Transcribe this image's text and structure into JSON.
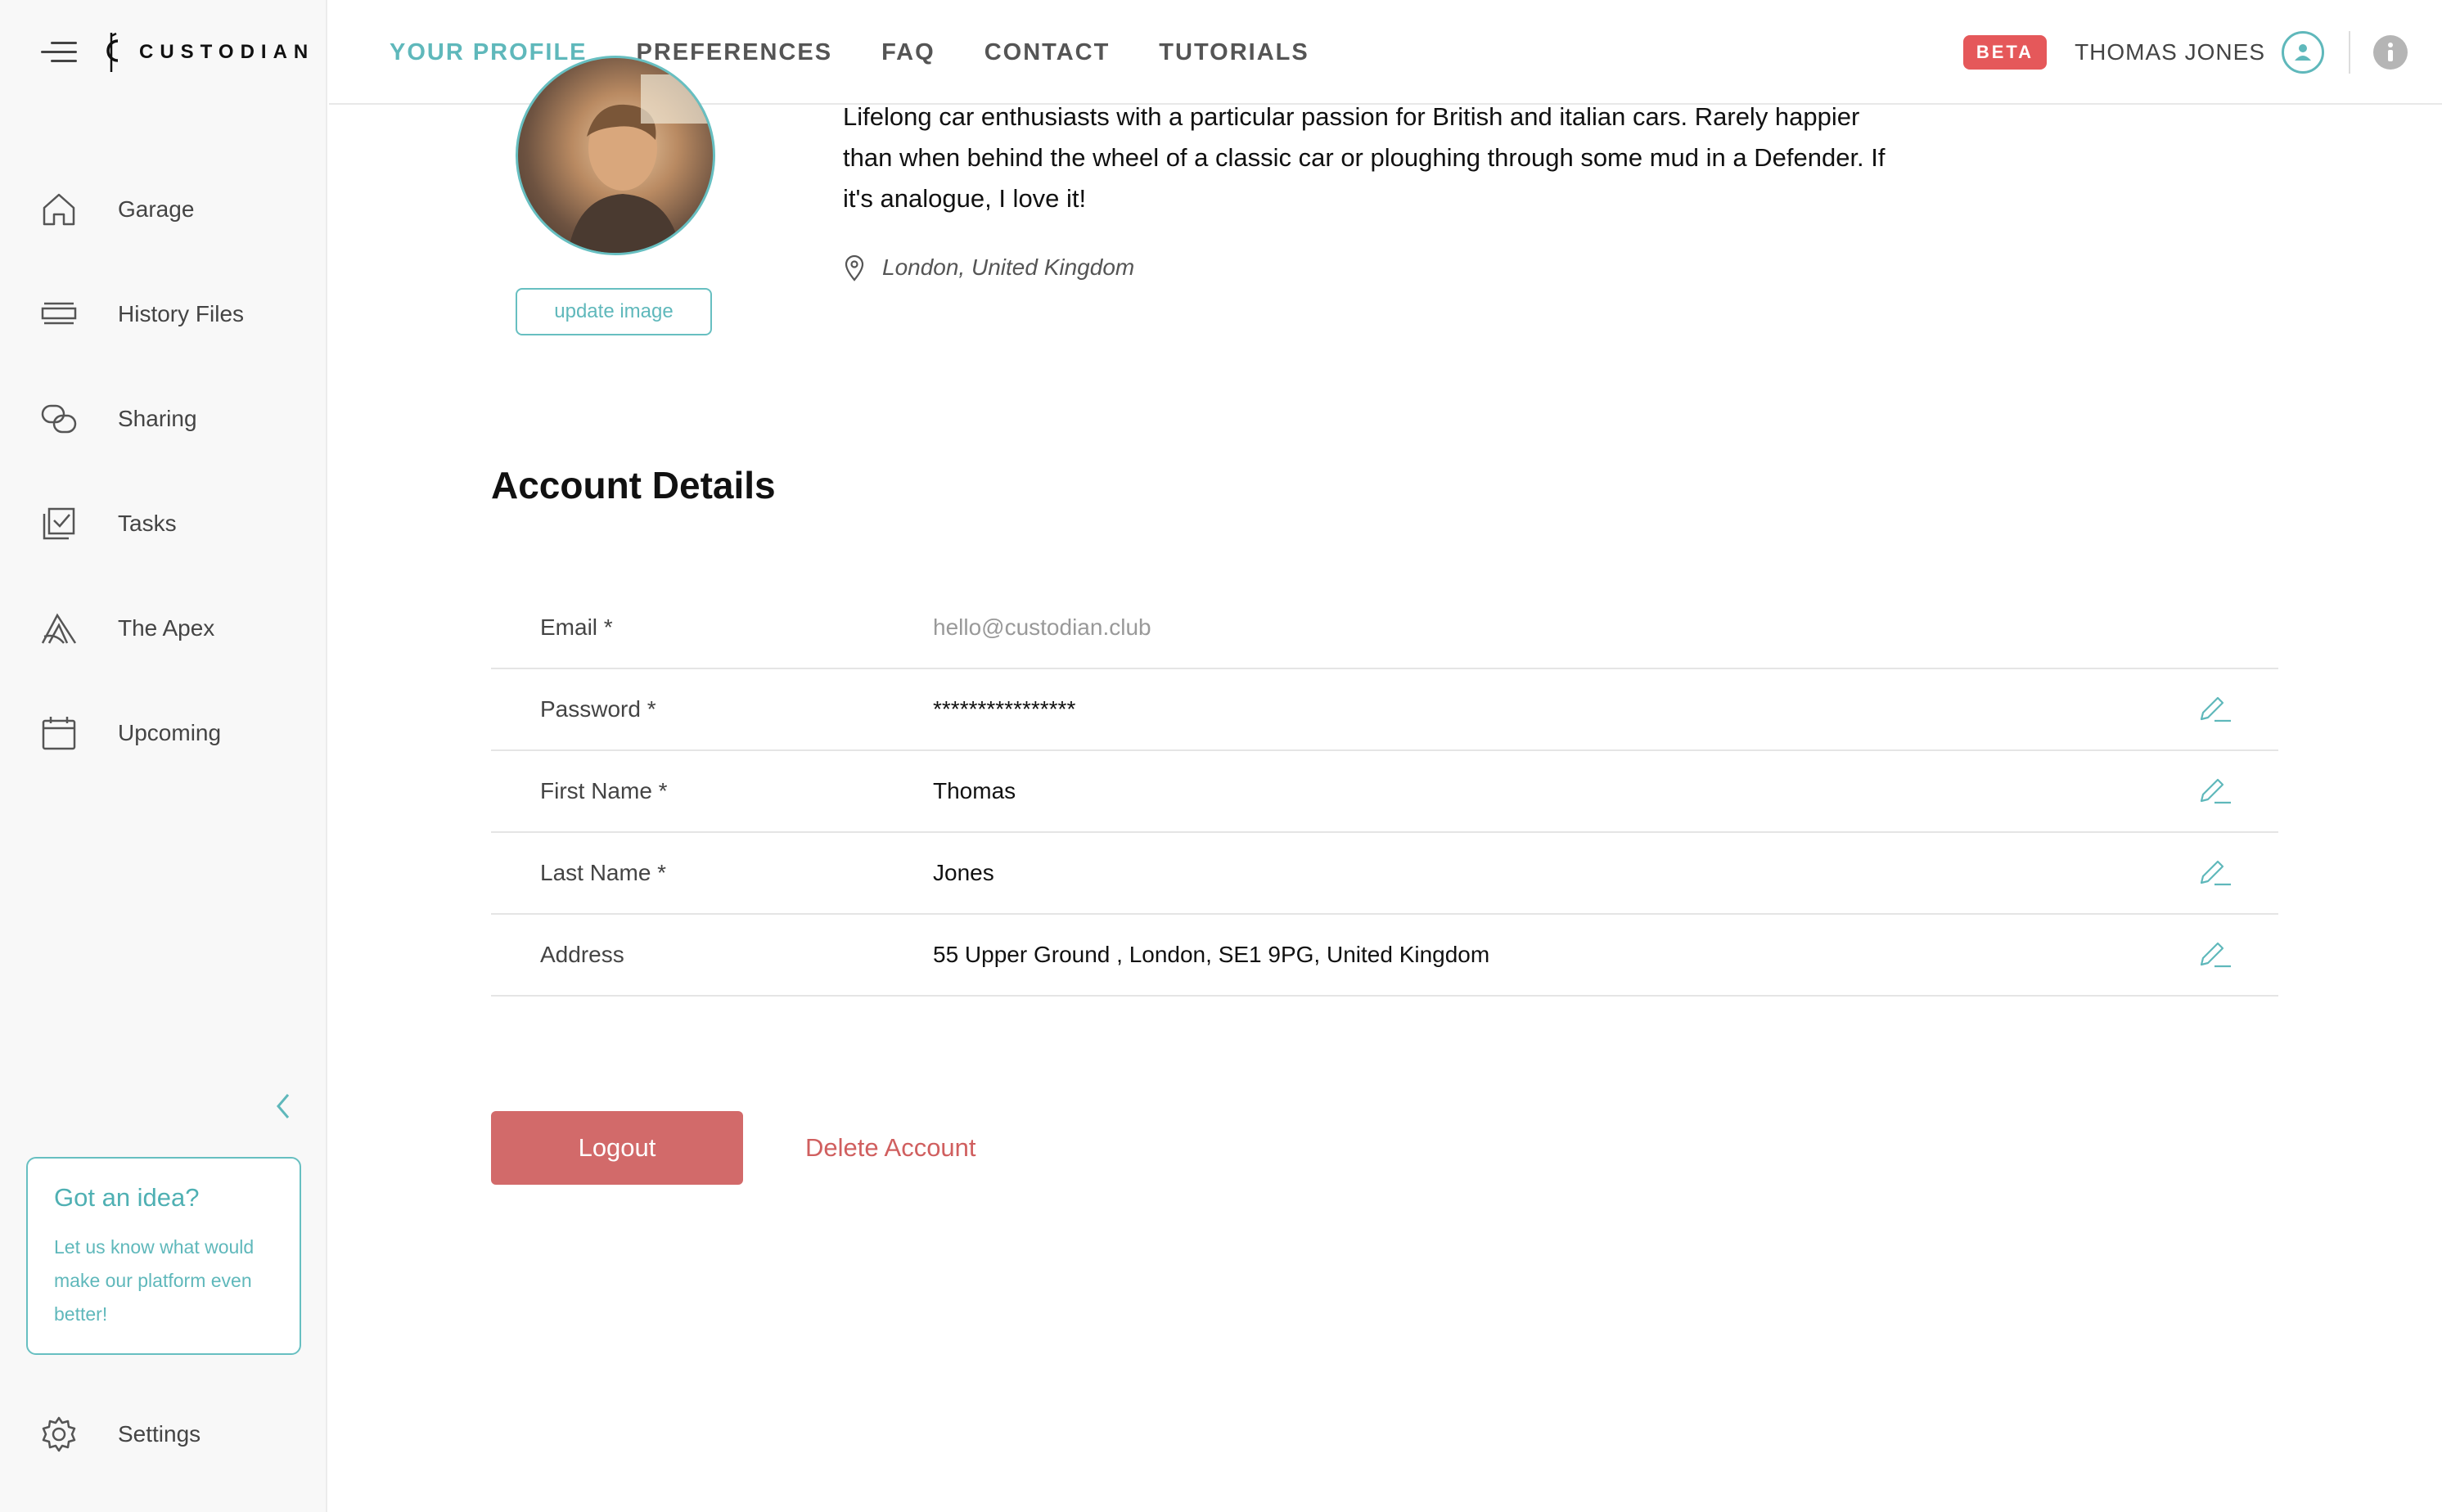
{
  "brand": {
    "name": "CUSTODIAN"
  },
  "sidebar": {
    "items": [
      {
        "label": "Garage",
        "icon": "home-icon"
      },
      {
        "label": "History Files",
        "icon": "history-files-icon"
      },
      {
        "label": "Sharing",
        "icon": "sharing-icon"
      },
      {
        "label": "Tasks",
        "icon": "tasks-icon"
      },
      {
        "label": "The Apex",
        "icon": "apex-icon"
      },
      {
        "label": "Upcoming",
        "icon": "calendar-icon"
      }
    ],
    "idea_card": {
      "title": "Got an idea?",
      "body": "Let us know what would make our platform even better!"
    },
    "settings_label": "Settings"
  },
  "header": {
    "tabs": [
      {
        "label": "YOUR PROFILE",
        "active": true
      },
      {
        "label": "PREFERENCES",
        "active": false
      },
      {
        "label": "FAQ",
        "active": false
      },
      {
        "label": "CONTACT",
        "active": false
      },
      {
        "label": "TUTORIALS",
        "active": false
      }
    ],
    "beta_badge": "BETA",
    "user_name": "THOMAS JONES"
  },
  "profile": {
    "update_image_label": "update image",
    "bio": "Lifelong car enthusiasts with a particular passion for British and italian cars. Rarely happier than when behind the wheel of a classic car or ploughing through some mud in a Defender. If it's analogue, I love it!",
    "location": "London, United Kingdom"
  },
  "account": {
    "title": "Account Details",
    "rows": [
      {
        "label": "Email *",
        "value": "hello@custodian.club",
        "editable": false
      },
      {
        "label": "Password *",
        "value": "****************",
        "editable": true
      },
      {
        "label": "First Name *",
        "value": "Thomas",
        "editable": true
      },
      {
        "label": "Last Name *",
        "value": "Jones",
        "editable": true
      },
      {
        "label": "Address",
        "value": "55 Upper Ground , London, SE1 9PG, United Kingdom",
        "editable": true
      }
    ]
  },
  "actions": {
    "logout_label": "Logout",
    "delete_label": "Delete Account"
  },
  "colors": {
    "accent": "#5fb8bb",
    "danger": "#d26a6a",
    "beta": "#e5585a"
  }
}
